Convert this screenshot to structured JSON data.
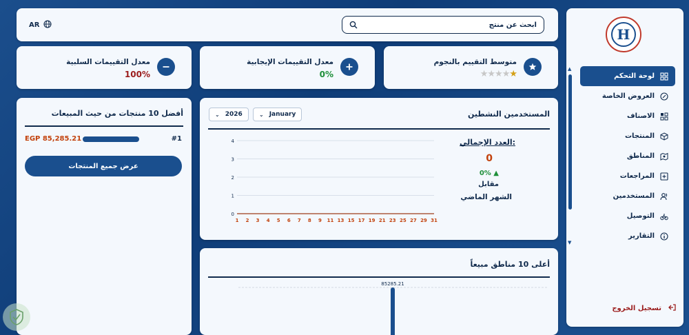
{
  "header": {
    "search_placeholder": "ابحث عن منتج",
    "language": "AR"
  },
  "sidebar": {
    "items": [
      {
        "label": "لوحة التحكم",
        "icon": "grid-icon",
        "active": true
      },
      {
        "label": "العروض الخاصة",
        "icon": "percent-icon",
        "active": false
      },
      {
        "label": "الاصناف",
        "icon": "categories-icon",
        "active": false
      },
      {
        "label": "المنتجات",
        "icon": "box-icon",
        "active": false
      },
      {
        "label": "المناطق",
        "icon": "map-icon",
        "active": false
      },
      {
        "label": "المراجعات",
        "icon": "review-icon",
        "active": false
      },
      {
        "label": "المستخدمين",
        "icon": "users-icon",
        "active": false
      },
      {
        "label": "التوصيل",
        "icon": "bike-icon",
        "active": false
      },
      {
        "label": "التقارير",
        "icon": "info-icon",
        "active": false
      }
    ],
    "logout_label": "تسجيل الخروج"
  },
  "stats": {
    "stars": {
      "title": "متوسط التقييم بالنجوم",
      "rating": 1,
      "max": 5
    },
    "positive": {
      "title": "معدل التقييمات الإيجابية",
      "value": "0%"
    },
    "negative": {
      "title": "معدل التقييمات السلبية",
      "value": "100%"
    }
  },
  "colors": {
    "primary": "#1a4f8e",
    "positive": "#1f8f3a",
    "negative": "#9b1c1c",
    "orange": "#c2410c"
  },
  "active_users": {
    "title": "المستخدمين النشطين",
    "month": "January",
    "year": "2026",
    "total_label": "العدد الإجمالي:",
    "total_value": "0",
    "change": "0%",
    "vs_label": "مقابل",
    "last_month_label": "الشهر الماضي",
    "chart_data": {
      "type": "line",
      "x": [
        "1",
        "2",
        "3",
        "4",
        "5",
        "6",
        "7",
        "8",
        "9",
        "11",
        "13",
        "15",
        "17",
        "19",
        "21",
        "23",
        "25",
        "27",
        "29",
        "31"
      ],
      "y_ticks": [
        "0",
        "1",
        "2",
        "3",
        "4"
      ],
      "ylim": [
        0,
        4
      ],
      "series": [
        {
          "values": [
            0,
            0,
            0,
            0,
            0,
            0,
            0,
            0,
            0,
            0,
            0,
            0,
            0,
            0,
            0,
            0,
            0,
            0,
            0,
            0
          ]
        }
      ]
    }
  },
  "top_regions": {
    "title": "أعلى 10 مناطق مبيعاً",
    "chart_data": {
      "type": "bar",
      "categories": [
        ""
      ],
      "values": [
        85285.21
      ],
      "data_labels": [
        "85285.21"
      ]
    }
  },
  "top_products": {
    "title": "أفضل 10 منتجات من حيث المبيعات",
    "items": [
      {
        "rank": "#1",
        "value": "EGP 85,285.21",
        "fraction": 1
      }
    ],
    "view_all_label": "عرض جميع المنتجات"
  }
}
